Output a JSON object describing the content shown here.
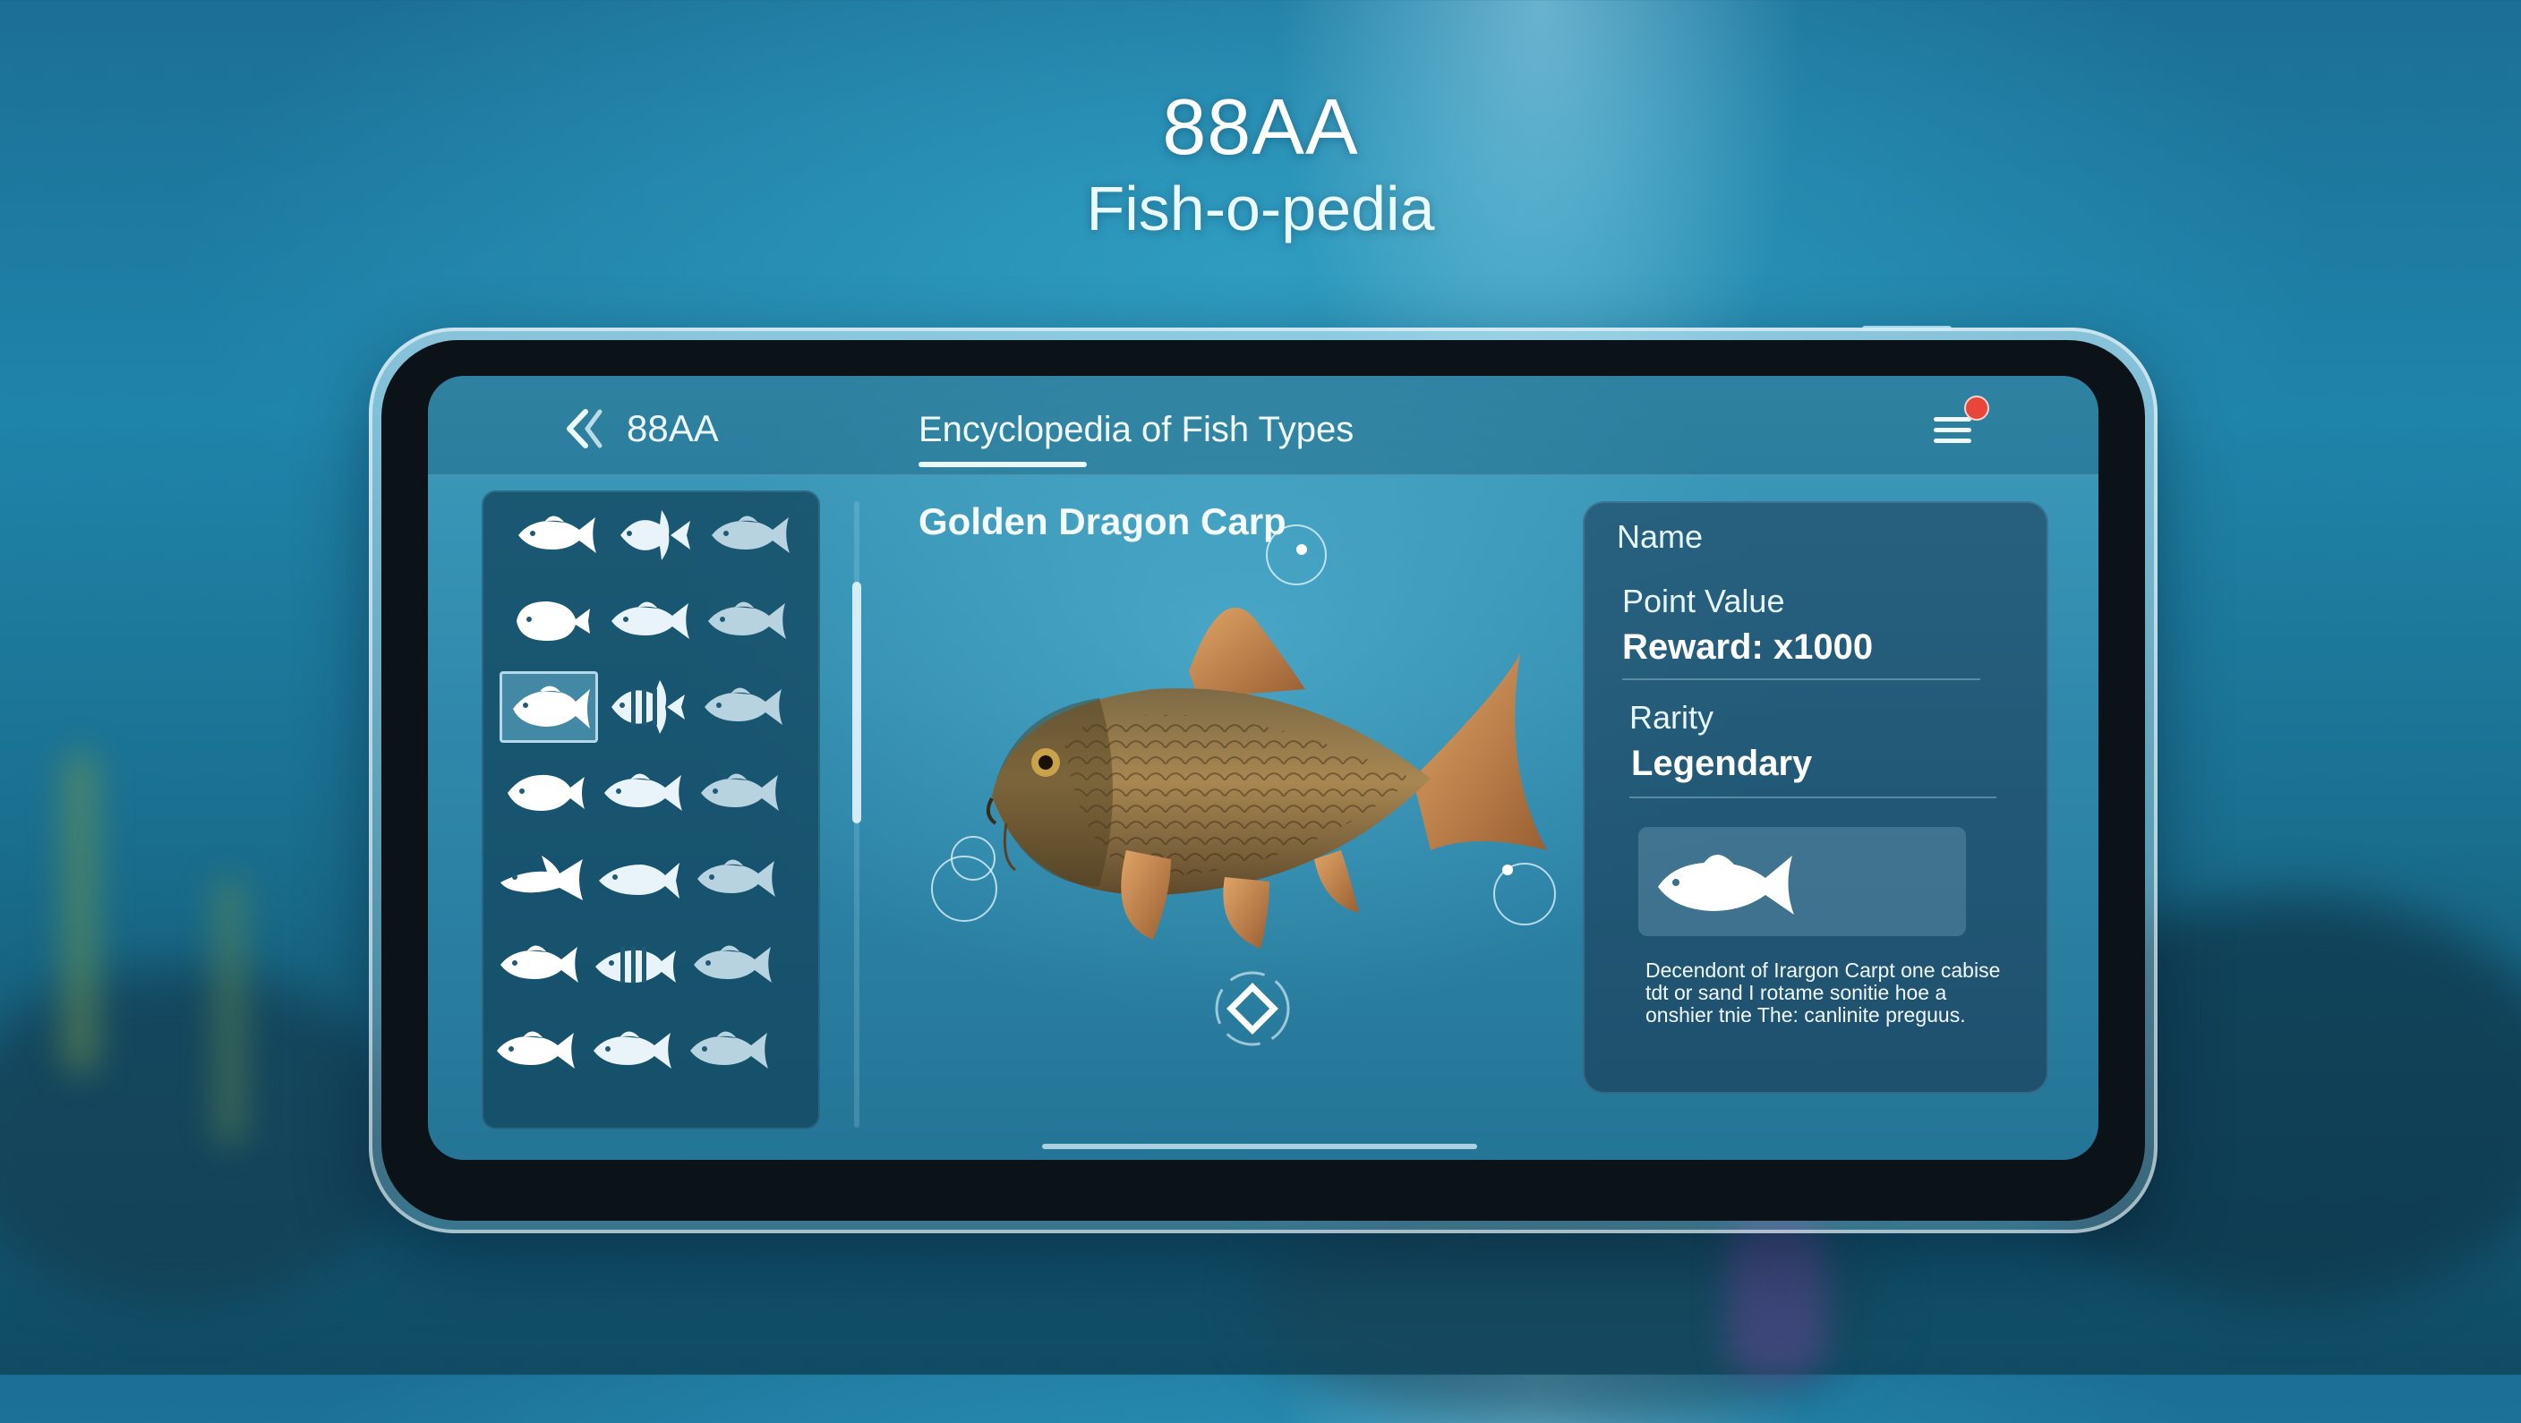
{
  "hero": {
    "title": "88AA",
    "subtitle": "Fish-o-pedia"
  },
  "header": {
    "back_icon": "double-chevron-left-icon",
    "brand": "88AA",
    "title": "Encyclopedia of Fish Types",
    "menu_icon": "hamburger-menu-icon",
    "notification_badge_color": "#e8463a"
  },
  "fish_grid": {
    "rows": 7,
    "columns": 3,
    "selected_index": 6,
    "icons": [
      "fish-icon",
      "angelfish-icon",
      "fish-icon",
      "pufferfish-icon",
      "fish-icon",
      "fish-icon",
      "carp-icon",
      "striped-angelfish-icon",
      "fish-icon",
      "spotted-fish-icon",
      "fish-icon",
      "fish-icon",
      "shark-icon",
      "tuna-icon",
      "fish-icon",
      "fish-icon",
      "striped-fish-icon",
      "fish-icon",
      "fish-icon",
      "fish-icon",
      "fish-icon"
    ]
  },
  "detail": {
    "fish_name": "Golden Dragon Carp",
    "rotate_icon": "rotate-diamond-icon"
  },
  "info": {
    "name_label": "Name",
    "point_value_label": "Point Value",
    "point_value": "Reward: x1000",
    "rarity_label": "Rarity",
    "rarity": "Legendary",
    "thumbnail_icon": "carp-icon",
    "description": "Decendont of Irargon Carpt one cabise tdt or sand I rotame sonitie hoe a onshier tnie The: canlinite preguus."
  },
  "colors": {
    "accent": "#e8f8ff",
    "badge": "#e8463a",
    "carp_body": "#8b6a3c",
    "carp_fin": "#c98a4e"
  }
}
